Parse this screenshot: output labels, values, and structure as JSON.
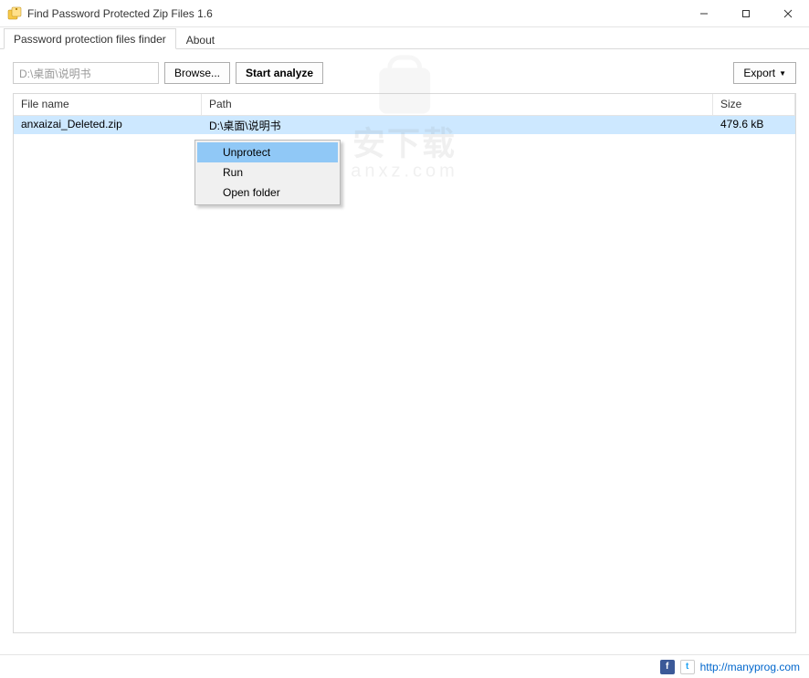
{
  "window": {
    "title": "Find Password Protected Zip Files 1.6"
  },
  "tabs": {
    "finder": "Password protection files finder",
    "about": "About"
  },
  "toolbar": {
    "path_value": "D:\\桌面\\说明书",
    "browse_label": "Browse...",
    "analyze_label": "Start analyze",
    "export_label": "Export"
  },
  "grid": {
    "headers": {
      "filename": "File name",
      "path": "Path",
      "size": "Size"
    },
    "rows": [
      {
        "filename": "anxaizai_Deleted.zip",
        "path": "D:\\桌面\\说明书",
        "size": "479.6 kB"
      }
    ]
  },
  "ctxmenu": {
    "unprotect": "Unprotect",
    "run": "Run",
    "open_folder": "Open folder"
  },
  "watermark": {
    "line1": "安下载",
    "line2": "anxz.com"
  },
  "statusbar": {
    "url": "http://manyprog.com"
  }
}
